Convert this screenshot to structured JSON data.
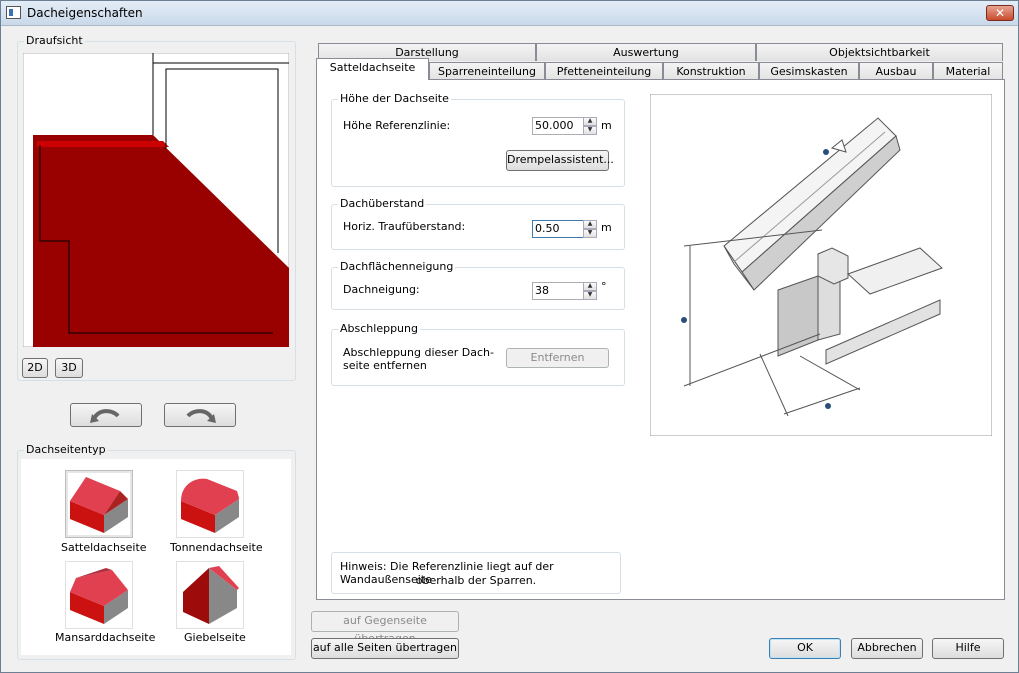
{
  "window": {
    "title": "Dacheigenschaften",
    "close_glyph": "✕"
  },
  "left": {
    "topview_label": "Draufsicht",
    "btn_2d": "2D",
    "btn_3d": "3D",
    "roof_type_label": "Dachseitentyp",
    "roof_types": [
      {
        "label": "Satteldachseite"
      },
      {
        "label": "Tonnendachseite"
      },
      {
        "label": "Mansarddachseite"
      },
      {
        "label": "Giebelseite"
      }
    ]
  },
  "tabs": {
    "row1": [
      "Darstellung",
      "Auswertung",
      "Objektsichtbarkeit"
    ],
    "row2": [
      "Satteldachseite",
      "Sparreneinteilung",
      "Pfetteneinteilung",
      "Konstruktion",
      "Gesimskasten",
      "Ausbau",
      "Material"
    ]
  },
  "panel": {
    "g1": {
      "title": "Höhe der Dachseite",
      "label": "Höhe Referenzlinie:",
      "value": "50.000",
      "unit": "m",
      "button": "Drempelassistent..."
    },
    "g2": {
      "title": "Dachüberstand",
      "label": "Horiz. Traufüberstand:",
      "value": "0.50",
      "unit": "m"
    },
    "g3": {
      "title": "Dachflächenneigung",
      "label": "Dachneigung:",
      "value": "38",
      "unit": "°"
    },
    "g4": {
      "title": "Abschleppung",
      "label_line1": "Abschleppung dieser Dach-",
      "label_line2": "seite entfernen",
      "button": "Entfernen"
    },
    "hint_line1": "Hinweis: Die Referenzlinie liegt auf der Wandaußenseite",
    "hint_line2": "oberhalb der Sparren."
  },
  "bottom": {
    "transfer_opposite": "auf Gegenseite übertragen",
    "transfer_all": "auf alle Seiten übertragen",
    "ok": "OK",
    "cancel": "Abbrechen",
    "help": "Hilfe"
  },
  "colors": {
    "roof_red": "#990000",
    "roof_red_light": "#cc0000",
    "accent": "#3c7fb1"
  }
}
